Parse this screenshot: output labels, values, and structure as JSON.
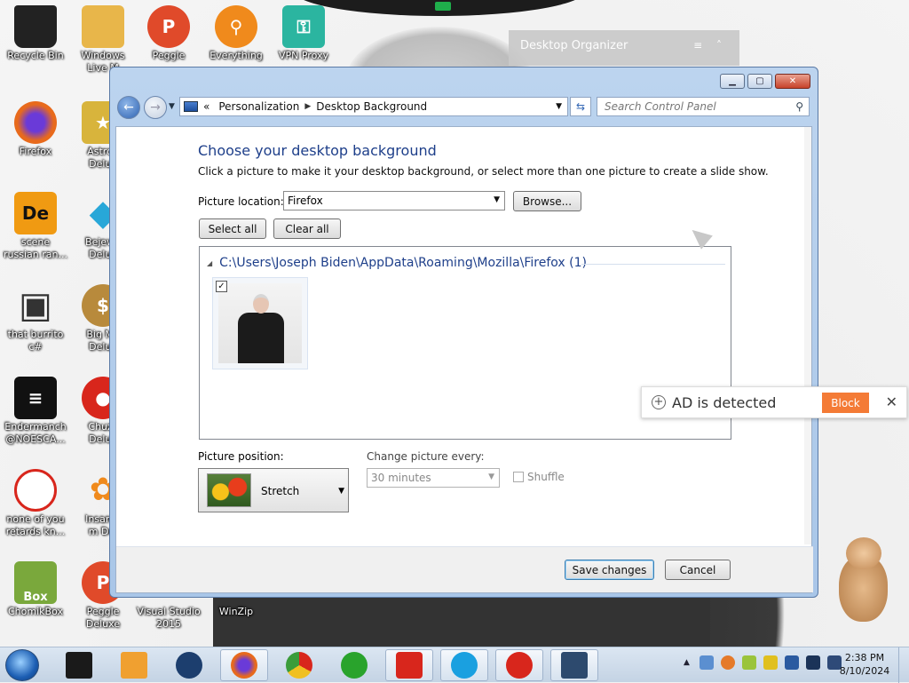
{
  "desktop": {
    "icons": [
      {
        "label": "Recycle Bin",
        "color": "#222222",
        "glyph": ""
      },
      {
        "label": "Windows\nLive M",
        "color": "#e8b64a",
        "glyph": ""
      },
      {
        "label": "Peggle",
        "color": "#e04a2a",
        "glyph": "P"
      },
      {
        "label": "Everything",
        "color": "#f08a1c",
        "glyph": "⚲"
      },
      {
        "label": "VPN Proxy",
        "color": "#2bb5a0",
        "glyph": "⚿"
      },
      {
        "label": "Firefox",
        "color": "#e86a1c",
        "glyph": ""
      },
      {
        "label": "Astrob\nDelux",
        "color": "#d8b43c",
        "glyph": "★"
      },
      {
        "label": "scene\nrussian ran...",
        "color": "#f09a12",
        "glyph": "De"
      },
      {
        "label": "Bejewe\nDelux",
        "color": "#28a7d8",
        "glyph": "◆"
      },
      {
        "label": "that burrito\nc#",
        "color": "#555555",
        "glyph": "▣"
      },
      {
        "label": "Big Mo\nDelux",
        "color": "#b88a3c",
        "glyph": "$"
      },
      {
        "label": "Endermanch\n@NOESCA...",
        "color": "#111111",
        "glyph": "≡"
      },
      {
        "label": "Chuzz\nDelux",
        "color": "#d8261c",
        "glyph": "●"
      },
      {
        "label": "none of you\nretards kn...",
        "color": "#d8261c",
        "glyph": ""
      },
      {
        "label": "Insaniq\nm Del",
        "color": "#f08a1c",
        "glyph": "✿"
      },
      {
        "label": "ChomikBox",
        "color": "#7aa83c",
        "glyph": "Box"
      },
      {
        "label": "Peggle\nDeluxe",
        "color": "#e04a2a",
        "glyph": "P"
      },
      {
        "label": "Visual Studio\n2015",
        "color": "",
        "glyph": ""
      },
      {
        "label": "WinZip",
        "color": "",
        "glyph": ""
      }
    ],
    "organizer_title": "Desktop Organizer"
  },
  "window": {
    "breadcrumb": [
      "Personalization",
      "Desktop Background"
    ],
    "breadcrumb_prefix": "«",
    "search_placeholder": "Search Control Panel",
    "heading": "Choose your desktop background",
    "subtext": "Click a picture to make it your desktop background, or select more than one picture to create a slide show.",
    "location_label": "Picture location:",
    "location_value": "Firefox",
    "browse_label": "Browse...",
    "select_all_label": "Select all",
    "clear_all_label": "Clear all",
    "group_path": "C:\\Users\\Joseph Biden\\AppData\\Roaming\\Mozilla\\Firefox (1)",
    "thumbnail_checked": "✓",
    "position_label": "Picture position:",
    "position_value": "Stretch",
    "change_every_label": "Change picture every:",
    "change_every_value": "30 minutes",
    "shuffle_label": "Shuffle",
    "save_label": "Save changes",
    "cancel_label": "Cancel"
  },
  "ad_popup": {
    "message": "AD is detected",
    "block_label": "Block",
    "close_glyph": "✕",
    "accent": "#f47b36"
  },
  "taskbar": {
    "items": [
      {
        "name": "taskbar-app-black",
        "color": "#1a1a1a"
      },
      {
        "name": "taskbar-app-media",
        "color": "#f0a030"
      },
      {
        "name": "taskbar-app-orb",
        "color": "#1c3e6e"
      },
      {
        "name": "taskbar-firefox",
        "color": "#e86a1c"
      },
      {
        "name": "taskbar-chrome",
        "color": "#3a9c3a"
      },
      {
        "name": "taskbar-ie",
        "color": "#29a32c"
      },
      {
        "name": "taskbar-wps",
        "color": "#d8261c"
      },
      {
        "name": "taskbar-skype",
        "color": "#1aa0e0"
      },
      {
        "name": "taskbar-app-red",
        "color": "#d8261c"
      },
      {
        "name": "taskbar-control-panel",
        "color": "#2d4a6e"
      }
    ],
    "time": "2:38 PM",
    "date": "8/10/2024"
  }
}
